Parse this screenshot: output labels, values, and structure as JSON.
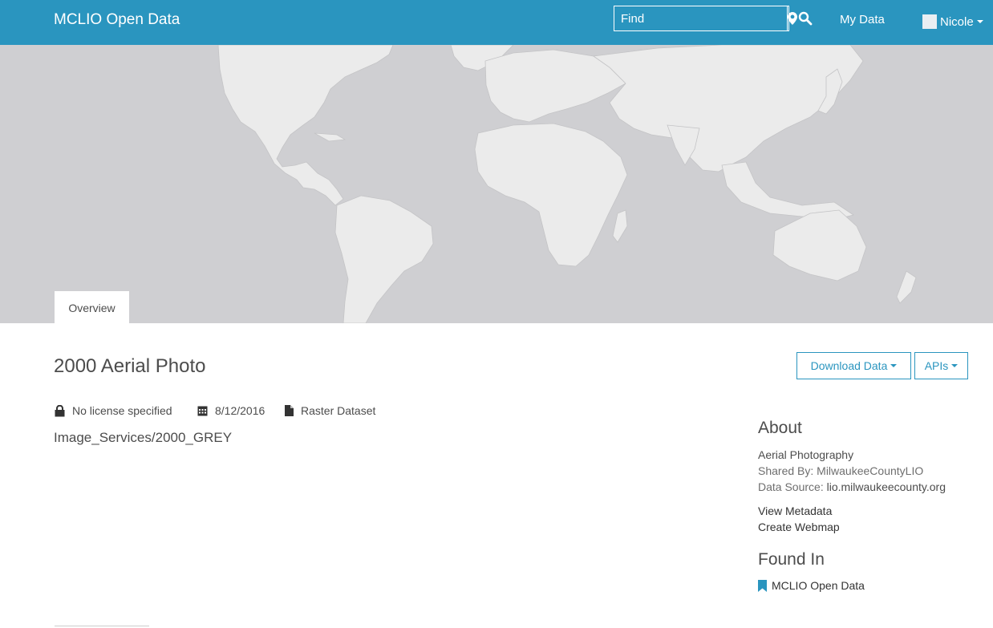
{
  "header": {
    "brand": "MCLIO Open Data",
    "search": {
      "placeholder": "Find",
      "value": ""
    },
    "my_data_label": "My Data",
    "user_name": "Nicole",
    "icons": {
      "locate": "map-marker-icon",
      "search": "search-icon"
    }
  },
  "tabs": [
    {
      "label": "Overview",
      "active": true
    }
  ],
  "dataset": {
    "title": "2000 Aerial Photo",
    "license": "No license specified",
    "date": "8/12/2016",
    "type": "Raster Dataset",
    "service_path": "Image_Services/2000_GREY"
  },
  "actions": {
    "download_label": "Download Data",
    "apis_label": "APIs"
  },
  "about": {
    "heading": "About",
    "category": "Aerial Photography",
    "shared_by_label": "Shared By:",
    "shared_by_value": "MilwaukeeCountyLIO",
    "data_source_label": "Data Source:",
    "data_source_value": "lio.milwaukeecounty.org",
    "view_metadata": "View Metadata",
    "create_webmap": "Create Webmap"
  },
  "found_in": {
    "heading": "Found In",
    "items": [
      "MCLIO Open Data"
    ]
  },
  "colors": {
    "header_bg": "#2a95bf",
    "accent": "#2a95bf",
    "map_water": "#cfcfd2",
    "map_land": "#ebebeb"
  }
}
